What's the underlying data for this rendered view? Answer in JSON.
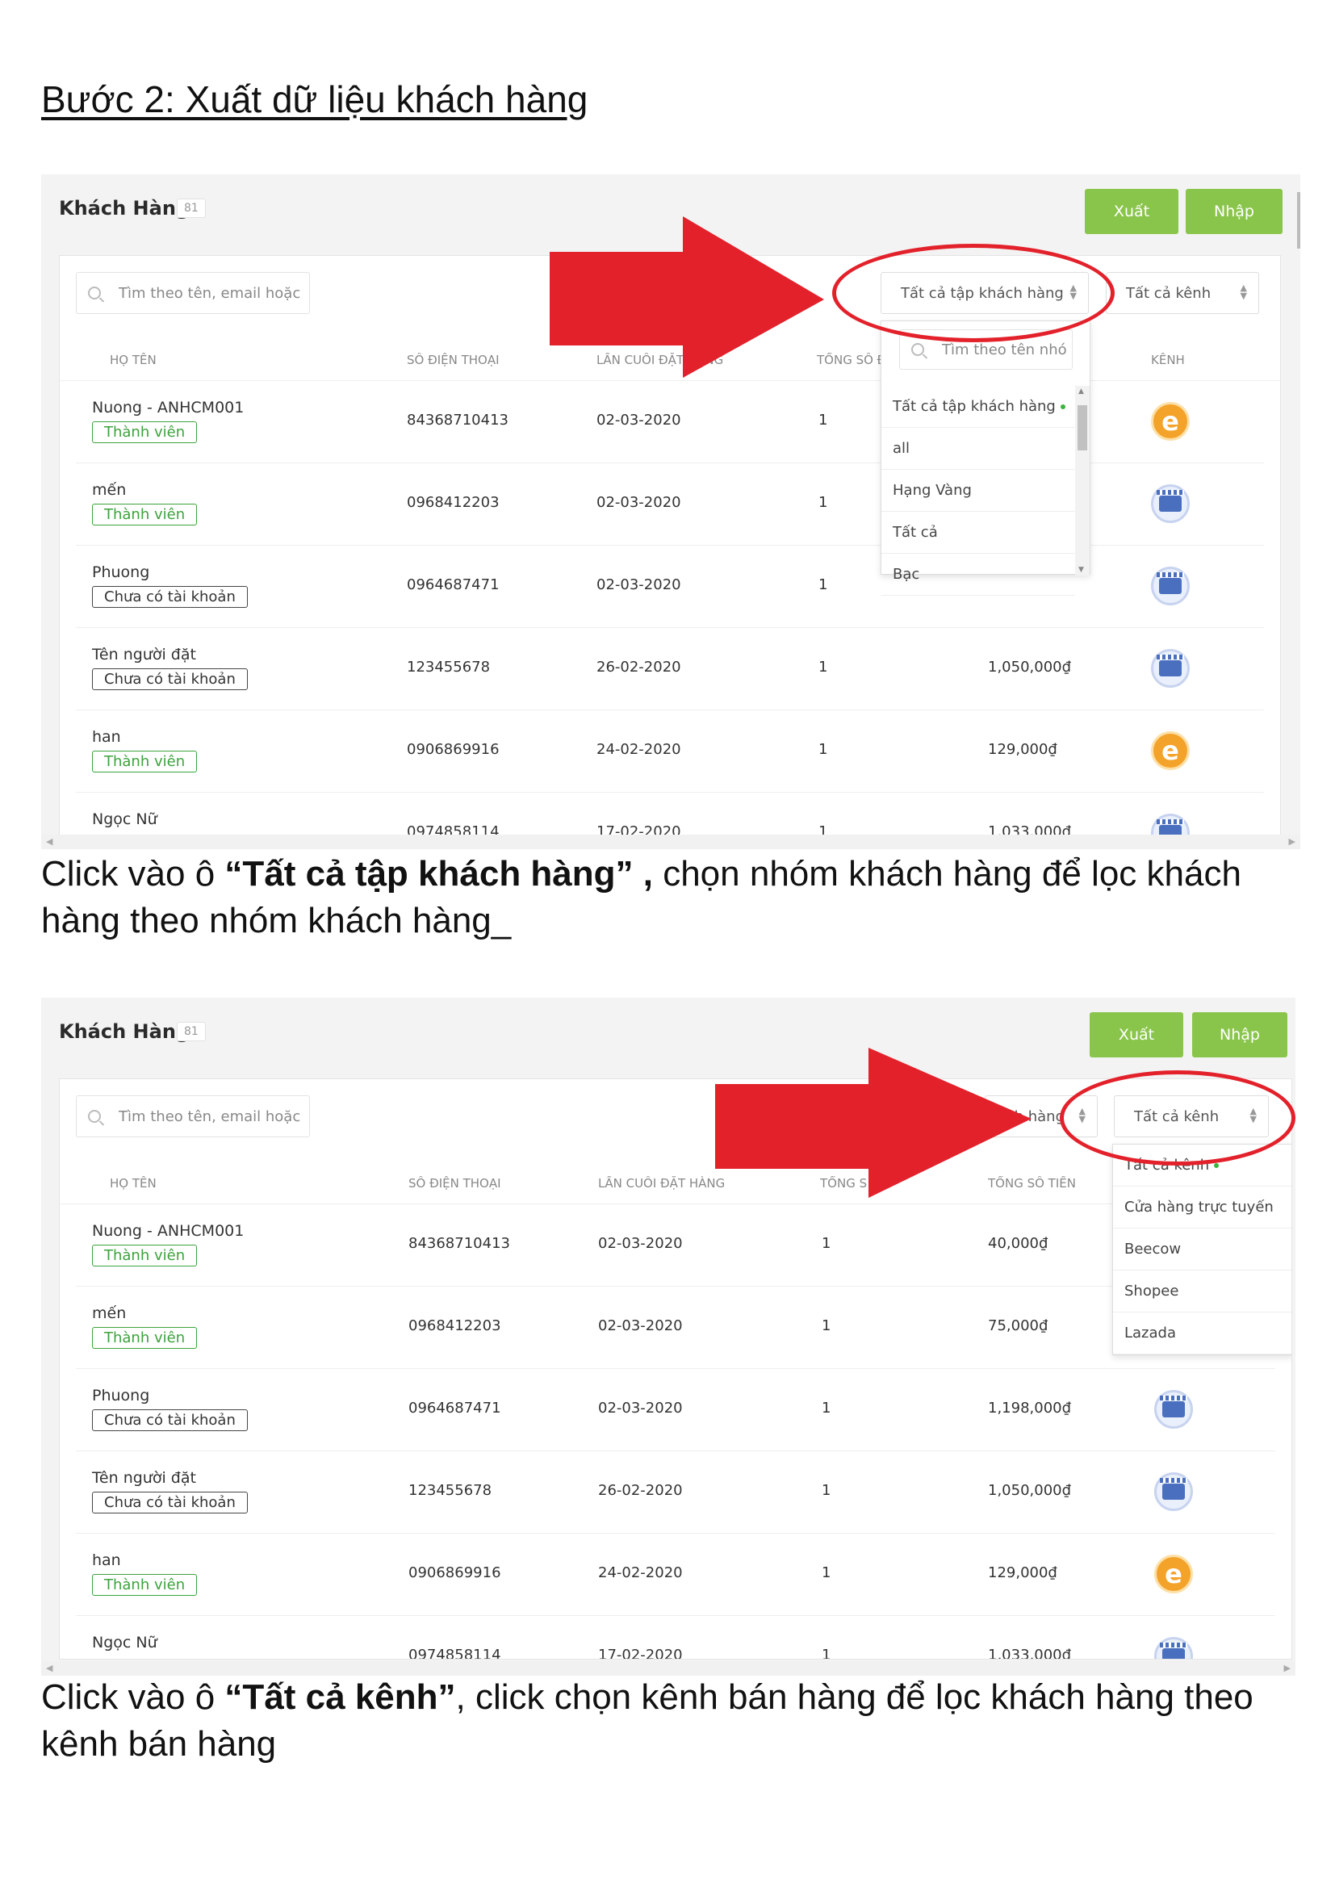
{
  "heading": "Bước 2: Xuất dữ liệu khách hàng",
  "caption1": {
    "pre": "Click vào ô ",
    "bold": "“Tất cả tập khách hàng” ,",
    "post": " chọn nhóm khách hàng để lọc khách hàng theo nhóm khách hàng_"
  },
  "caption2": {
    "pre": "Click vào ô ",
    "bold": "“Tất cả kênh”",
    "post": ", click chọn kênh bán hàng để lọc khách hàng theo kênh bán hàng"
  },
  "app": {
    "title": "Khách Hàng",
    "count": "81",
    "export_label": "Xuất",
    "import_label": "Nhập",
    "search_placeholder": "Tìm theo tên, email hoặc",
    "group_select": "Tất cả tập khách hàng",
    "group_select_partial": "h hàng",
    "channel_select": "Tất cả kênh",
    "columns": {
      "name": "HỌ TÊN",
      "phone": "SỐ ĐIỆN THOẠI",
      "last_order": "LẦN CUỐI ĐẶT HÀNG",
      "last_order_partial": "LẦN CUỐI ĐẶT HÀNG",
      "total_orders_partial1": "TỔNG SỐ Đ",
      "total_orders_partial2": "TỔNG S",
      "total_amount": "TỔNG SỐ TIỀN",
      "channel": "KÊNH"
    },
    "rows": [
      {
        "name": "Nuong - ANHCM001",
        "badge": "Thành viên",
        "phone": "84368710413",
        "date": "02-03-2020",
        "orders": "1",
        "amount": "40,000₫",
        "channel": "e"
      },
      {
        "name": "mến",
        "badge": "Thành viên",
        "phone": "0968412203",
        "date": "02-03-2020",
        "orders": "1",
        "amount": "75,000₫",
        "channel": "shop"
      },
      {
        "name": "Phuong",
        "badge": "Chưa có tài khoản",
        "phone": "0964687471",
        "date": "02-03-2020",
        "orders": "1",
        "amount": "1,198,000₫",
        "channel": "shop"
      },
      {
        "name": "Tên người đặt",
        "badge": "Chưa có tài khoản",
        "phone": "123455678",
        "date": "26-02-2020",
        "orders": "1",
        "amount": "1,050,000₫",
        "channel": "shop"
      },
      {
        "name": "han",
        "badge": "Thành viên",
        "phone": "0906869916",
        "date": "24-02-2020",
        "orders": "1",
        "amount": "129,000₫",
        "channel": "e"
      },
      {
        "name": "Ngọc Nữ",
        "badge": "",
        "phone": "0974858114",
        "date": "17-02-2020",
        "orders": "1",
        "amount": "1,033,000₫",
        "channel": "shop"
      }
    ],
    "group_dropdown": {
      "search_placeholder": "Tìm theo tên nhó",
      "items": [
        "Tất cả tập khách hàng",
        "all",
        "Hạng Vàng",
        "Tất cả",
        "Bạc"
      ]
    },
    "channel_dropdown": {
      "items": [
        "Tất cả kênh",
        "Cửa hàng trực tuyến",
        "Beecow",
        "Shopee",
        "Lazada"
      ]
    }
  },
  "colors": {
    "accent": "#8ac54b",
    "annotation": "#e3212b",
    "member": "#3ca23c"
  }
}
